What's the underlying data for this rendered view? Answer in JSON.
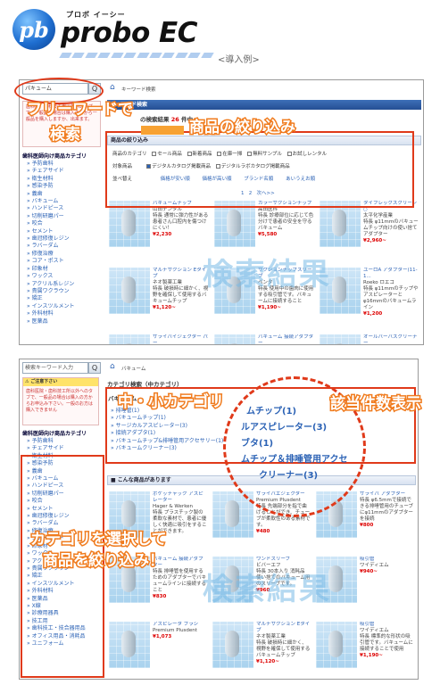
{
  "logo": {
    "badge": "pb",
    "kana": "プロボ イーシー",
    "name": "probo EC",
    "example_label": "<導入例>"
  },
  "screen1": {
    "search_value": "パキューム",
    "search_button": "Q",
    "breadcrumb": "キーワード検索",
    "notice_text": "歯科用、歯科技工用以外へのタブで、一般品の場合は購入の方から一般品を購入しますか、出来ます。",
    "category_head": "歯科医師向け商品カテゴリ",
    "categories": [
      "予防歯科",
      "チェアサイド",
      "衛生材料",
      "感染予防",
      "義歯",
      "バキューム",
      "ハンドピース",
      "切削研磨パー",
      "咬合",
      "セメント",
      "歯冠修復レジン",
      "ラバーダム",
      "修復治療",
      "コア・ポスト",
      "印象材",
      "ワックス",
      "アクリル系レジン",
      "貴属ワクラウン",
      "矯正",
      "インスツルメント",
      "外科材料",
      "医薬品"
    ],
    "title": "キーワード検索",
    "result_prefix": "の検索結果",
    "result_count": "26",
    "result_suffix": "件中",
    "filter_head": "商品の絞り込み",
    "filter_type_label": "商品のカテゴリ",
    "filter_types": [
      "セール商品",
      "新着商品",
      "在庫一掃",
      "無料サンプル",
      "お試しレンタル"
    ],
    "filter_target_label": "対象商品",
    "filter_targets": [
      "デジタルカタログ掲載商品",
      "デジタルラボカタログ掲載商品"
    ],
    "sort_label": "並べ替え",
    "sort_options": [
      "価格が安い順",
      "価格が高い順",
      "ブランド名順",
      "あいうえお順"
    ],
    "pagination": [
      "1",
      "2",
      "次へ>>"
    ],
    "products": [
      {
        "name": "バキュームチップ",
        "maker": "山田デンタル",
        "desc": "特長 通常に弾力性がある患者さん口腔内を傷つけにくい！",
        "price": "¥2,230"
      },
      {
        "name": "カラーサクションチップ",
        "maker": "高田医科",
        "desc": "特長 診療部位に応じて色分けで患者の安全を守るバキューム",
        "price": "¥5,580"
      },
      {
        "name": "タイフレックスクリーン○",
        "maker": "太平化学産業",
        "desc": "特長 φ11mmのバキュームチップ向けの使い捨てアダプター",
        "price": "¥2,960~"
      },
      {
        "name": "マルチサクション Eタイプ",
        "maker": "ネオ製薬工業",
        "desc": "特長 破損時に細かく、視野を確保して使用するバキュームチップ",
        "price": "¥1,120~"
      },
      {
        "name": "サクションチップスリーブ",
        "maker": "ペンタ",
        "desc": "特長 使用中の歯肉に使用する吸引管です。バキュームに接続すること",
        "price": "¥1,190~"
      },
      {
        "name": "ユーロA アダプター(11-1...",
        "maker": "Roeko ロエコ",
        "desc": "特長 φ11mmのチップやアスピレーターとφ16mmのバキュームライン",
        "price": "¥1,200"
      },
      {
        "name": "サライバイジェクター パー",
        "maker": "",
        "desc": "",
        "price": ""
      },
      {
        "name": "バキューム 接続アダプター",
        "maker": "",
        "desc": "",
        "price": ""
      },
      {
        "name": "オールバーバスクリーナー",
        "maker": "",
        "desc": "",
        "price": ""
      }
    ],
    "callout_freeword": "フリーワードで",
    "callout_search": "検索",
    "callout_filter": "商品の絞り込み",
    "watermark": "検索結果"
  },
  "screen2": {
    "search_placeholder": "検索キーワード入力",
    "search_button": "Q",
    "breadcrumb": "バキューム",
    "notice_head": "ご注意下さい",
    "notice_text": "歯科医院・歯科技工所以外へのタブで、一般品の場合は購入の方からお申込み下さい。一般のお方は購入できません",
    "category_head": "歯科医師向け商品カテゴリ",
    "categories": [
      "予防歯科",
      "チェアサイド",
      "衛生材料",
      "感染予防",
      "義歯",
      "バキューム",
      "ハンドピース",
      "切削研磨パー",
      "咬合",
      "セメント",
      "歯冠修復レジン",
      "ラバーダム",
      "修復治療",
      "コア・ポスト",
      "印象材",
      "ワックス",
      "アクリル系レジン",
      "貴属ワクラウン",
      "矯正",
      "インスツルメント",
      "外科材料",
      "医薬品",
      "X線",
      "診療用器具",
      "技工用",
      "歯科技工・技合器用品",
      "オフィス用品・消耗品",
      "ユニフォーム"
    ],
    "title": "カテゴリ検索（中カテゴリ）",
    "subcat_head": "バキューム",
    "subcats": [
      "排唾管(1)",
      "バキュームチップ(1)",
      "サージカルアスピレーター(3)",
      "接続アダプタ(1)",
      "バキュームチップ&排唾管用アクセサリー(1)",
      "バキュームクリーナー(3)"
    ],
    "products_head": "こんな商品があります",
    "products": [
      {
        "name": "ポケッチャック アスピレーター",
        "maker": "Hager & Werken",
        "desc": "特長 プラスチック製の柔軟な素材で、患者に優しく快適に吸引をすることができます。",
        "price": ""
      },
      {
        "name": "サライバエジェクター",
        "maker": "Premium Plusdent",
        "desc": "特長 先端部分を指で曲げることができ、チューブが柔軟性のある素材です。",
        "price": "¥480"
      },
      {
        "name": "サライバ アダプター",
        "maker": "",
        "desc": "特長 φ6.5mmで接続できる排唾管用のチューブにφ11mmのアダプターを接続",
        "price": "¥800"
      },
      {
        "name": "バキューム 接続アダプター",
        "maker": "",
        "desc": "特長 排唾管を使用するためのアダプターでバキュームラインに接続すること",
        "price": "¥830"
      },
      {
        "name": "ワンドスリーブ",
        "maker": "ビバーエフ",
        "desc": "特長 30本入り 消耗品 使い捨てのバキューム用のスリーブです。",
        "price": "¥960"
      },
      {
        "name": "吸引管",
        "maker": "ワイディエム",
        "desc": "",
        "price": "¥940~"
      },
      {
        "name": "アスピレータ ブラシ",
        "maker": "Premium Plusdent",
        "desc": "",
        "price": "¥1,073"
      },
      {
        "name": "マルチサクション Eタイプ",
        "maker": "ネオ製薬工業",
        "desc": "特長 破損時に細かく、視野を確保して使用するバキュームチップ",
        "price": "¥1,120~"
      },
      {
        "name": "吸引管",
        "maker": "ワイディエム",
        "desc": "特長 標準的な形状の吸引管です。バキュームに接続することで使用",
        "price": "¥1,190~"
      }
    ],
    "callout_category": "中・小カテゴリ",
    "callout_count": "該当件数表示",
    "callout_select": "カテゴリを選択して",
    "callout_narrow": "商品を絞り込み！",
    "zoom_items": [
      "ムチップ(1)",
      "ルアスピレーター(3)",
      "ブタ(1)",
      "ムチップ＆排唾管用アクセ",
      "クリーナー(3)"
    ],
    "watermark": "検索結果"
  }
}
